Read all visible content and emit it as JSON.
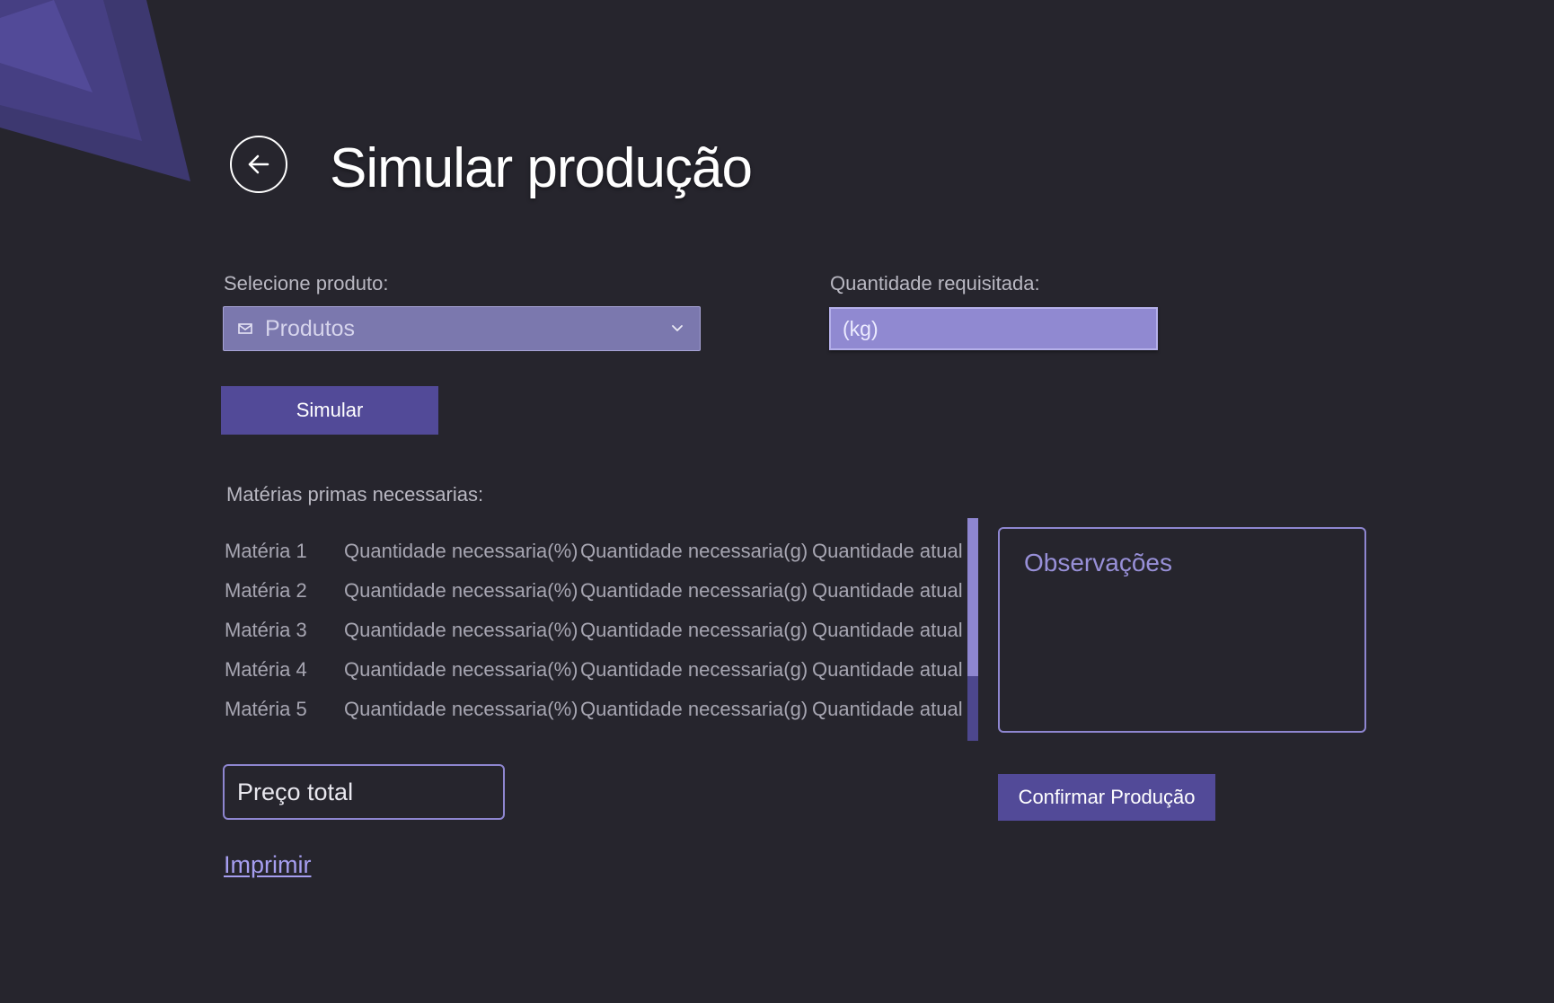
{
  "header": {
    "title": "Simular produção"
  },
  "product": {
    "label": "Selecione produto:",
    "selected": "Produtos"
  },
  "quantity": {
    "label": "Quantidade requisitada:",
    "placeholder": "(kg)"
  },
  "actions": {
    "simulate_label": "Simular",
    "confirm_label": "Confirmar Produção",
    "print_label": "Imprimir"
  },
  "materials": {
    "label": "Matérias primas necessarias:",
    "rows": [
      {
        "name": "Matéria 1",
        "qty_percent": "Quantidade necessaria(%)",
        "qty_grams": "Quantidade necessaria(g)",
        "current_qty": "Quantidade atual"
      },
      {
        "name": "Matéria 2",
        "qty_percent": "Quantidade necessaria(%)",
        "qty_grams": "Quantidade necessaria(g)",
        "current_qty": "Quantidade atual"
      },
      {
        "name": "Matéria 3",
        "qty_percent": "Quantidade necessaria(%)",
        "qty_grams": "Quantidade necessaria(g)",
        "current_qty": "Quantidade atual"
      },
      {
        "name": "Matéria 4",
        "qty_percent": "Quantidade necessaria(%)",
        "qty_grams": "Quantidade necessaria(g)",
        "current_qty": "Quantidade atual"
      },
      {
        "name": "Matéria 5",
        "qty_percent": "Quantidade necessaria(%)",
        "qty_grams": "Quantidade necessaria(g)",
        "current_qty": "Quantidade atual"
      }
    ]
  },
  "observations": {
    "placeholder": "Observações"
  },
  "total_price": {
    "label": "Preço total"
  },
  "icons": {
    "back": "arrow-left-icon",
    "select_prefix": "mail-icon",
    "select_toggle": "chevron-down-icon"
  },
  "colors": {
    "background": "#26252d",
    "accent": "#524a98",
    "select_fill": "#7b78ae",
    "input_fill": "#9089d1",
    "outline": "#8e86d0",
    "link": "#a69ef0"
  }
}
